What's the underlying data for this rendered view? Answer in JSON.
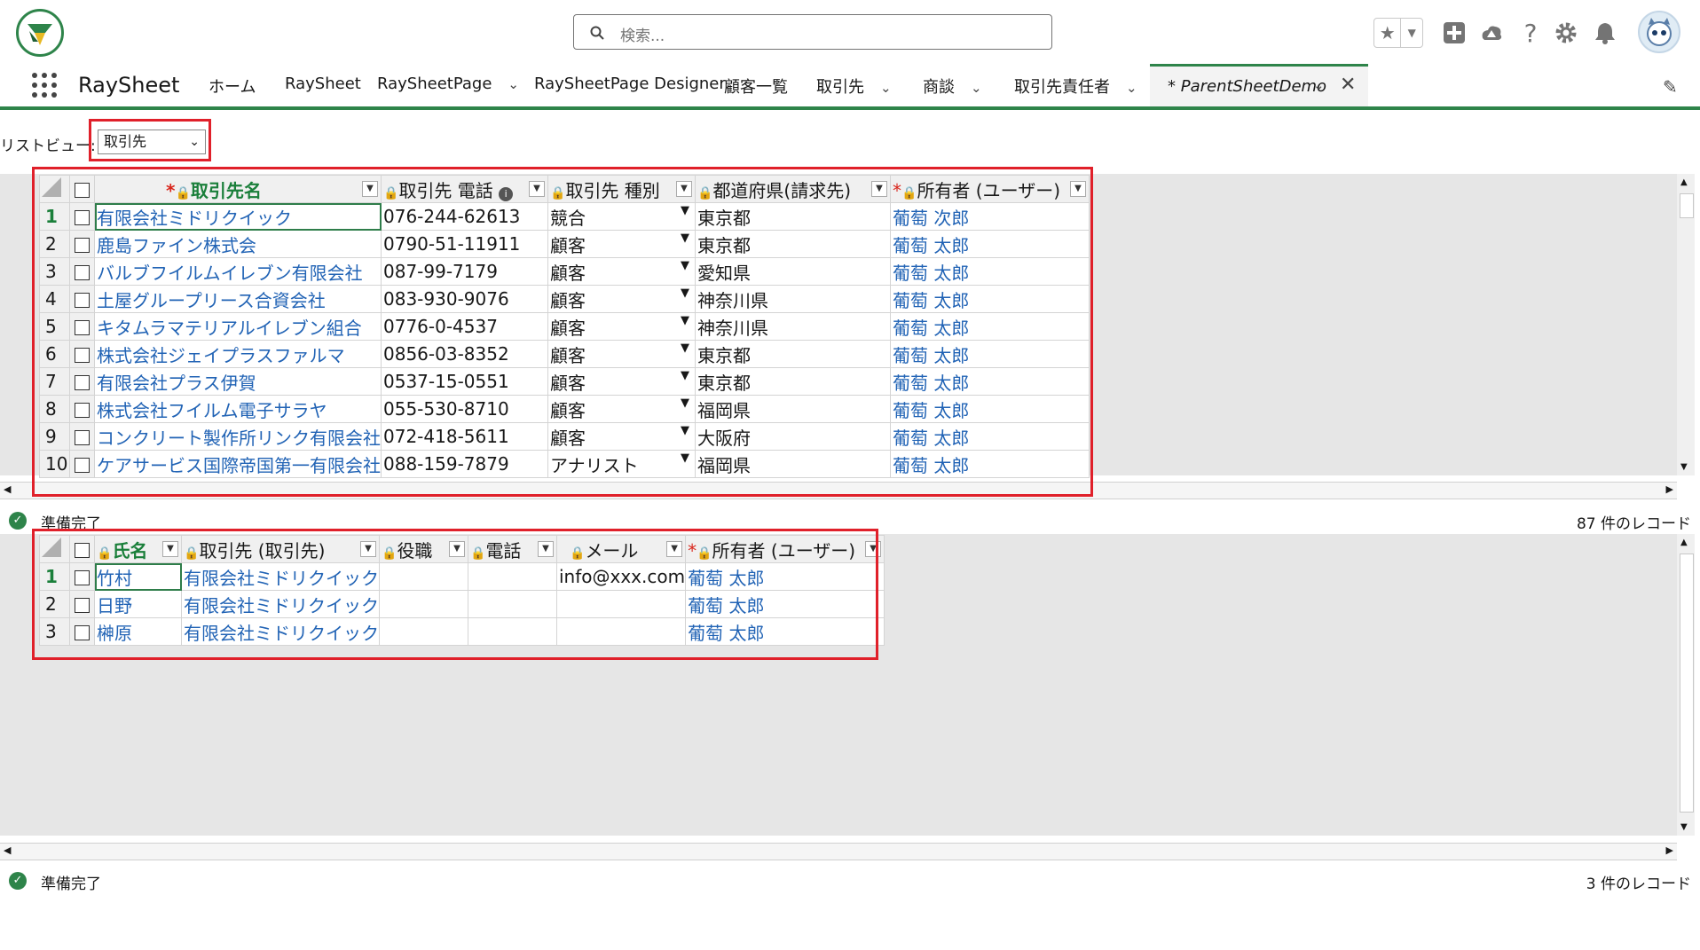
{
  "header": {
    "search_placeholder": "検索...",
    "app_name": "RaySheet",
    "tabs": [
      {
        "label": "ホーム",
        "has_menu": false
      },
      {
        "label": "RaySheet",
        "has_menu": false
      },
      {
        "label": "RaySheetPage",
        "has_menu": true
      },
      {
        "label": "RaySheetPage Designer",
        "has_menu": false
      },
      {
        "label": "顧客一覧",
        "has_menu": false
      },
      {
        "label": "取引先",
        "has_menu": true
      },
      {
        "label": "商談",
        "has_menu": true
      },
      {
        "label": "取引先責任者",
        "has_menu": true
      }
    ],
    "active_tab": "* ParentSheetDemo",
    "accent_color": "#2e844a"
  },
  "list_view": {
    "label": "リストビュー:",
    "selected": "取引先"
  },
  "parent_sheet": {
    "columns": [
      "取引先名",
      "取引先 電話",
      "取引先 種別",
      "都道府県(請求先)",
      "所有者 (ユーザー)"
    ],
    "rows": [
      {
        "num": "1",
        "name": "有限会社ミドリクイック",
        "phone": "076-244-62613",
        "type": "競合",
        "pref": "東京都",
        "owner": "葡萄 次郎"
      },
      {
        "num": "2",
        "name": "鹿島ファイン株式会",
        "phone": "0790-51-11911",
        "type": "顧客",
        "pref": "東京都",
        "owner": "葡萄 太郎"
      },
      {
        "num": "3",
        "name": "バルブフイルムイレブン有限会社",
        "phone": "087-99-7179",
        "type": "顧客",
        "pref": "愛知県",
        "owner": "葡萄 太郎"
      },
      {
        "num": "4",
        "name": "土屋グループリース合資会社",
        "phone": "083-930-9076",
        "type": "顧客",
        "pref": "神奈川県",
        "owner": "葡萄 太郎"
      },
      {
        "num": "5",
        "name": "キタムラマテリアルイレブン組合",
        "phone": "0776-0-4537",
        "type": "顧客",
        "pref": "神奈川県",
        "owner": "葡萄 太郎"
      },
      {
        "num": "6",
        "name": "株式会社ジェイプラスファルマ",
        "phone": "0856-03-8352",
        "type": "顧客",
        "pref": "東京都",
        "owner": "葡萄 太郎"
      },
      {
        "num": "7",
        "name": "有限会社プラス伊賀",
        "phone": "0537-15-0551",
        "type": "顧客",
        "pref": "東京都",
        "owner": "葡萄 太郎"
      },
      {
        "num": "8",
        "name": "株式会社フイルム電子サラヤ",
        "phone": "055-530-8710",
        "type": "顧客",
        "pref": "福岡県",
        "owner": "葡萄 太郎"
      },
      {
        "num": "9",
        "name": "コンクリート製作所リンク有限会社",
        "phone": "072-418-5611",
        "type": "顧客",
        "pref": "大阪府",
        "owner": "葡萄 太郎"
      },
      {
        "num": "10",
        "name": "ケアサービス国際帝国第一有限会社",
        "phone": "088-159-7879",
        "type": "アナリスト",
        "pref": "福岡県",
        "owner": "葡萄 太郎"
      }
    ],
    "status": "準備完了",
    "record_count": "87 件のレコード"
  },
  "child_sheet": {
    "columns": [
      "氏名",
      "取引先 (取引先)",
      "役職",
      "電話",
      "メール",
      "所有者 (ユーザー)"
    ],
    "rows": [
      {
        "num": "1",
        "name": "竹村",
        "account": "有限会社ミドリクイック",
        "title": "",
        "phone": "",
        "email": "info@xxx.com",
        "owner": "葡萄 太郎"
      },
      {
        "num": "2",
        "name": "日野",
        "account": "有限会社ミドリクイック",
        "title": "",
        "phone": "",
        "email": "",
        "owner": "葡萄 太郎"
      },
      {
        "num": "3",
        "name": "榊原",
        "account": "有限会社ミドリクイック",
        "title": "",
        "phone": "",
        "email": "",
        "owner": "葡萄 太郎"
      }
    ],
    "status": "準備完了",
    "record_count": "3 件のレコード"
  }
}
